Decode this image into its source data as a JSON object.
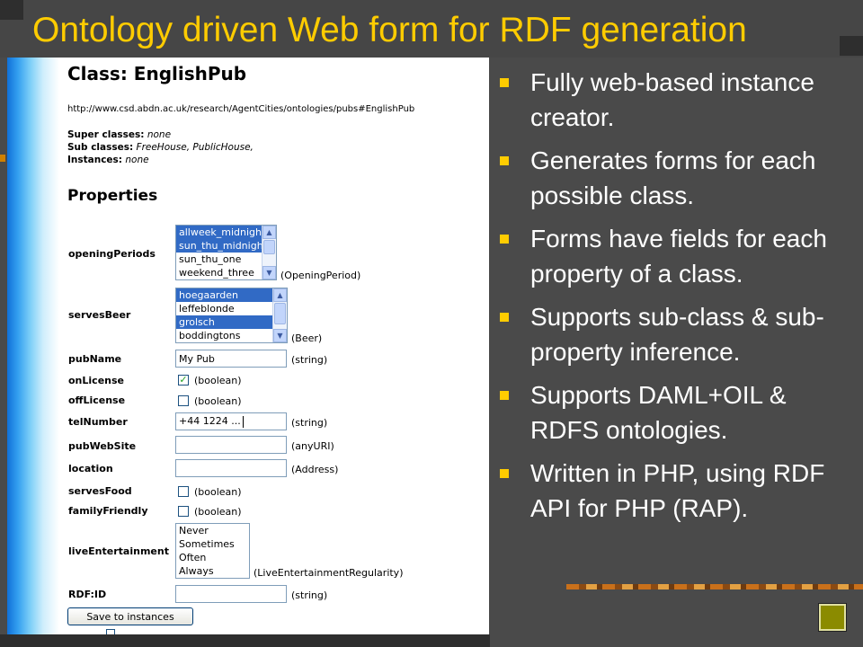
{
  "slide": {
    "title": "Ontology driven Web form for RDF generation",
    "bullets": [
      "Fully web-based instance creator.",
      "Generates forms for each possible class.",
      "Forms have fields for each property of a class.",
      "Supports sub-class & sub-property inference.",
      "Supports DAML+OIL & RDFS ontologies.",
      "Written in PHP, using RDF API for PHP (RAP)."
    ],
    "colors": {
      "title": "#ffcc00",
      "bullet_text": "#ffffff",
      "bullet_marker": "#ffcc00",
      "background": "#4a4a4a"
    }
  },
  "form": {
    "class_title": "Class: EnglishPub",
    "class_url": "http://www.csd.abdn.ac.uk/research/AgentCities/ontologies/pubs#EnglishPub",
    "super_classes": {
      "label": "Super classes:",
      "value": "none"
    },
    "sub_classes": {
      "label": "Sub classes:",
      "value": "FreeHouse, PublicHouse,"
    },
    "instances": {
      "label": "Instances:",
      "value": "none"
    },
    "properties_heading": "Properties",
    "opening_periods": {
      "label": "openingPeriods",
      "type": "(OpeningPeriod)",
      "options": [
        "allweek_midnight",
        "sun_thu_midnight",
        "sun_thu_one",
        "weekend_three"
      ],
      "selected": [
        true,
        true,
        false,
        false
      ]
    },
    "serves_beer": {
      "label": "servesBeer",
      "type": "(Beer)",
      "options": [
        "hoegaarden",
        "leffeblonde",
        "grolsch",
        "boddingtons"
      ],
      "selected": [
        true,
        false,
        true,
        false
      ]
    },
    "pub_name": {
      "label": "pubName",
      "value": "My Pub",
      "type": "(string)"
    },
    "on_license": {
      "label": "onLicense",
      "checked": true,
      "type": "(boolean)"
    },
    "off_license": {
      "label": "offLicense",
      "checked": false,
      "type": "(boolean)"
    },
    "tel_number": {
      "label": "telNumber",
      "value": "+44 1224 ...",
      "type": "(string)"
    },
    "pub_web_site": {
      "label": "pubWebSite",
      "value": "",
      "type": "(anyURI)"
    },
    "location": {
      "label": "location",
      "value": "",
      "type": "(Address)"
    },
    "serves_food": {
      "label": "servesFood",
      "checked": false,
      "type": "(boolean)"
    },
    "family_friendly": {
      "label": "familyFriendly",
      "checked": false,
      "type": "(boolean)"
    },
    "live_entertainment": {
      "label": "liveEntertainment",
      "type": "(LiveEntertainmentRegularity)",
      "options": [
        "Never",
        "Sometimes",
        "Often",
        "Always"
      ]
    },
    "rdf_id": {
      "label": "RDF:ID",
      "value": "",
      "type": "(string)"
    },
    "save_button": "Save to instances"
  }
}
